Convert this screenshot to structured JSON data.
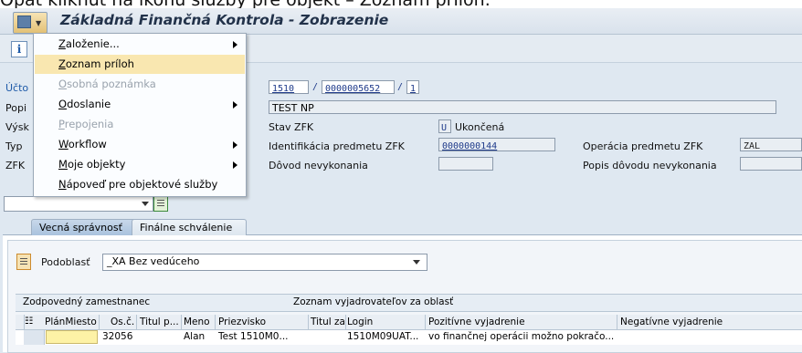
{
  "caption": "Opäť kliknúť na ikonu služby pre objekt – Zoznam príloh.",
  "window": {
    "title": "Základná Finančná Kontrola - Zobrazenie"
  },
  "toolbar": {
    "info_label": "i"
  },
  "menu": {
    "items": [
      {
        "label": "Založenie...",
        "ul": "Z",
        "rest": "aloženie...",
        "submenu": true,
        "disabled": false,
        "selected": false
      },
      {
        "label": "Zoznam príloh",
        "ul": "Z",
        "rest": "oznam príloh",
        "submenu": false,
        "disabled": false,
        "selected": true
      },
      {
        "label": "Osobná poznámka",
        "ul": "O",
        "rest": "sobná poznámka",
        "submenu": false,
        "disabled": true,
        "selected": false
      },
      {
        "label": "Odoslanie",
        "ul": "O",
        "rest": "doslanie",
        "submenu": true,
        "disabled": false,
        "selected": false
      },
      {
        "label": "Prepojenia",
        "ul": "P",
        "rest": "repojenia",
        "submenu": false,
        "disabled": true,
        "selected": false
      },
      {
        "label": "Workflow",
        "ul": "W",
        "rest": "orkflow",
        "submenu": true,
        "disabled": false,
        "selected": false
      },
      {
        "label": "Moje objekty",
        "ul": "M",
        "rest": "oje objekty",
        "submenu": true,
        "disabled": false,
        "selected": false
      },
      {
        "label": "Nápoveď pre objektové služby",
        "ul": "N",
        "rest": "ápoveď pre objektové služby",
        "submenu": false,
        "disabled": false,
        "selected": false
      }
    ]
  },
  "form": {
    "left_labels": [
      "Účto",
      "Popi",
      "Výsk",
      "Typ",
      "ZFK"
    ],
    "doc_company": "1510",
    "doc_sep1": "/",
    "doc_number": "0000005652",
    "doc_sep2": "/",
    "doc_line": "1",
    "description": "TEST NP",
    "stav_label": "Stav ZFK",
    "stav_code": "U",
    "stav_text": "Ukončená",
    "identifikacia_label": "Identifikácia predmetu ZFK",
    "identifikacia_value": "0000000144",
    "dovod_label": "Dôvod nevykonania",
    "dovod_value": "",
    "operacia_label": "Operácia predmetu ZFK",
    "operacia_value": "ZAL",
    "popis_dovodu_label": "Popis dôvodu nevykonania",
    "popis_dovodu_value": ""
  },
  "tabs": [
    {
      "label": "Vecná správnosť",
      "active": true
    },
    {
      "label": "Finálne schválenie",
      "active": false
    }
  ],
  "podoblast": {
    "label": "Podoblasť",
    "value": "_XA Bez vedúceho"
  },
  "table": {
    "group_headers": [
      "Zodpovedný zamestnanec",
      "Zoznam vyjadrovateľov za oblasť"
    ],
    "columns": [
      "PlánMiesto",
      "Os.č.",
      "Titul p...",
      "Meno",
      "Priezvisko",
      "Titul za",
      "Login",
      "Pozitívne vyjadrenie",
      "Negatívne vyjadrenie"
    ],
    "rows": [
      {
        "plan_miesto": "",
        "os_c": "32056",
        "titul_p": "",
        "meno": "Alan",
        "priezvisko": "Test 1510M0...",
        "titul_za": "",
        "login": "1510M09UAT...",
        "pozitivne": "vo finančnej operácii možno pokračo...",
        "negativne": ""
      }
    ]
  }
}
